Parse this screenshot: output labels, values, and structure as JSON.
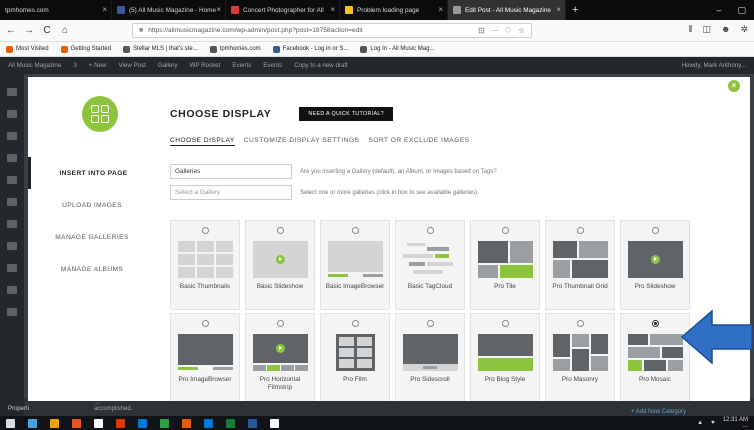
{
  "browser": {
    "tabs": [
      {
        "label": "tpmhomes.com",
        "favicon": "#888888",
        "active": false
      },
      {
        "label": "(5) All Music Magazine - Home",
        "favicon": "#3b5998",
        "active": false
      },
      {
        "label": "Concert Photographer for All",
        "favicon": "#d83b3b",
        "active": false
      },
      {
        "label": "Problem loading page",
        "favicon": "#f0c419",
        "active": false
      },
      {
        "label": "Edit Post - All Music Magazine",
        "favicon": "#999999",
        "active": true
      }
    ],
    "new_tab_glyph": "+",
    "tab_close_glyph": "×",
    "window_controls": [
      "–",
      "▢"
    ],
    "url": "https://allmusicmagazine.com/wp-admin/post.php?post=18758action=edit",
    "url_icons": [
      "⊡",
      "···",
      "♡",
      "☆"
    ],
    "nav_icons": [
      "←",
      "→",
      "C",
      "⌂"
    ],
    "toolbar_icons": [
      "⫴",
      "◫",
      "☻",
      "✲"
    ],
    "bookmarks": [
      {
        "label": "Most Visited",
        "color": "#e66000"
      },
      {
        "label": "Getting Started",
        "color": "#e66000"
      },
      {
        "label": "Stellar MLS | that's ste...",
        "color": "#555555"
      },
      {
        "label": "tpmhomes.com",
        "color": "#555555"
      },
      {
        "label": "Facebook - Log in or S...",
        "color": "#3b5998"
      },
      {
        "label": "Log In - All Music Mag...",
        "color": "#555555"
      }
    ]
  },
  "adminbar": {
    "items": [
      "All Music Magazine",
      "3",
      "+ New",
      "View Post",
      "Gallery",
      "WP Rocket",
      "Events",
      "Events",
      "Copy to a new draft"
    ],
    "right": "Howdy, Mark Anthony..."
  },
  "background": {
    "text_line1": "...",
    "text_line2": "accomplished.",
    "link": "+ Add New Category",
    "left_label": "Properti"
  },
  "taskbar": {
    "time": "12:31 AM",
    "date": "...",
    "icon_colors": [
      "#dddddd",
      "#4aa3df",
      "#f0a30a",
      "#e95420",
      "#ffffff",
      "#d83b01",
      "#0078d7",
      "#2e9e45",
      "#e66000",
      "#0078d7",
      "#1b7a3b",
      "#2b579a",
      "#ffffff"
    ]
  },
  "modal": {
    "close_glyph": "×",
    "title": "CHOOSE DISPLAY",
    "tutorial_button": "NEED A QUICK TUTORIAL?",
    "tabs": [
      "CHOOSE DISPLAY",
      "CUSTOMIZE DISPLAY SETTINGS",
      "SORT OR EXCLUDE IMAGES"
    ],
    "sidenav": [
      "INSERT INTO PAGE",
      "UPLOAD IMAGES",
      "MANAGE GALLERIES",
      "MANAGE ALBUMS"
    ],
    "source_field": {
      "value": "Galleries",
      "help": "Are you inserting a Gallery (default), an Album, or Images based on Tags?"
    },
    "gallery_field": {
      "placeholder": "Select a Gallery",
      "help": "Select one or more galleries (click in box to see available galleries)."
    },
    "displays": [
      {
        "label": "Basic Thumbnails",
        "kind": "thumbs"
      },
      {
        "label": "Basic Slideshow",
        "kind": "slideshow-light"
      },
      {
        "label": "Basic ImageBrowser",
        "kind": "imagebrowser-light"
      },
      {
        "label": "Basic TagCloud",
        "kind": "tagcloud"
      },
      {
        "label": "Pro Tile",
        "kind": "tile"
      },
      {
        "label": "Pro Thumbnail Grid",
        "kind": "thumbgrid"
      },
      {
        "label": "Pro Slideshow",
        "kind": "slideshow-dark"
      },
      {
        "label": "Pro ImageBrowser",
        "kind": "imagebrowser-dark"
      },
      {
        "label": "Pro Horizontal Filmstrip",
        "kind": "filmstrip"
      },
      {
        "label": "Pro Film",
        "kind": "film"
      },
      {
        "label": "Pro Sidescroll",
        "kind": "sidescroll"
      },
      {
        "label": "Pro Blog Style",
        "kind": "blog"
      },
      {
        "label": "Pro Masonry",
        "kind": "masonry"
      },
      {
        "label": "Pro Mosaic",
        "kind": "mosaic",
        "selected": true
      }
    ],
    "accent_color": "#8cc43d",
    "pointer_color": "#2f6fc4"
  }
}
